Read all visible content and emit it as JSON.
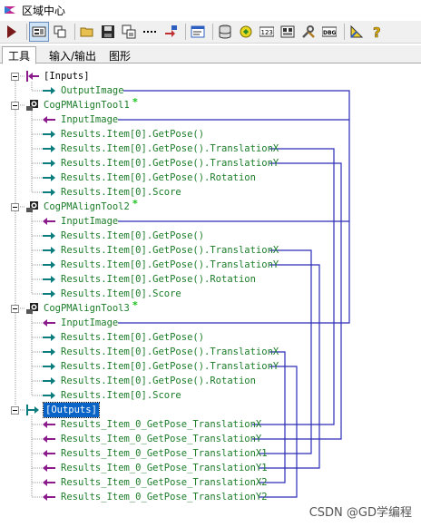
{
  "window": {
    "title": "区域中心"
  },
  "toolbar": {
    "buttons": [
      {
        "icon": "run-icon"
      },
      {
        "icon": "grid-view-icon",
        "pressed": true
      },
      {
        "icon": "link-icon"
      },
      {
        "icon": "open-folder-icon"
      },
      {
        "icon": "save-icon"
      },
      {
        "icon": "copy-icon"
      },
      {
        "icon": "dots-icon"
      },
      {
        "icon": "import-icon"
      },
      {
        "icon": "screen-icon"
      },
      {
        "icon": "database-icon"
      },
      {
        "icon": "refresh-icon"
      },
      {
        "icon": "numeric-icon"
      },
      {
        "icon": "image-icon"
      },
      {
        "icon": "tools-icon"
      },
      {
        "icon": "debug-icon"
      },
      {
        "icon": "measure-icon"
      },
      {
        "icon": "help-icon"
      }
    ]
  },
  "tabs": [
    "工具",
    "输入/输出",
    "图形"
  ],
  "tree": {
    "inputs": "[Inputs]",
    "output_image": "OutputImage",
    "tools": [
      {
        "name": "CogPMAlignTool1",
        "items": [
          "InputImage",
          "Results.Item[0].GetPose()",
          "Results.Item[0].GetPose().TranslationX",
          "Results.Item[0].GetPose().TranslationY",
          "Results.Item[0].GetPose().Rotation",
          "Results.Item[0].Score"
        ]
      },
      {
        "name": "CogPMAlignTool2",
        "items": [
          "InputImage",
          "Results.Item[0].GetPose()",
          "Results.Item[0].GetPose().TranslationX",
          "Results.Item[0].GetPose().TranslationY",
          "Results.Item[0].GetPose().Rotation",
          "Results.Item[0].Score"
        ]
      },
      {
        "name": "CogPMAlignTool3",
        "items": [
          "InputImage",
          "Results.Item[0].GetPose()",
          "Results.Item[0].GetPose().TranslationX",
          "Results.Item[0].GetPose().TranslationY",
          "Results.Item[0].GetPose().Rotation",
          "Results.Item[0].Score"
        ]
      }
    ],
    "outputs": "[Outputs]",
    "output_items": [
      "Results_Item_0_GetPose_TranslationX",
      "Results_Item_0_GetPose_TranslationY",
      "Results_Item_0_GetPose_TranslationX1",
      "Results_Item_0_GetPose_TranslationY1",
      "Results_Item_0_GetPose_TranslationX2",
      "Results_Item_0_GetPose_TranslationY2"
    ]
  },
  "watermark": "CSDN @GD学编程",
  "colors": {
    "link_line": "#2b2bb8",
    "input_arrow": "#8b1a8b",
    "output_arrow": "#0d7c7c",
    "selected": "#0a64c8"
  }
}
